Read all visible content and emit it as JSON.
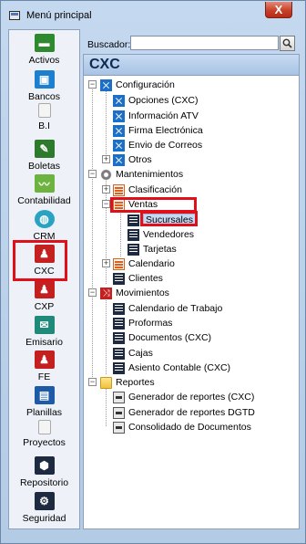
{
  "window": {
    "title": "Menú principal",
    "close_label": "X"
  },
  "sidebar": {
    "items": [
      {
        "label": "Activos",
        "icon": "activos-icon",
        "color": "#2f8a2f"
      },
      {
        "label": "Bancos",
        "icon": "bancos-icon",
        "color": "#1d7fd0"
      },
      {
        "label": "B.I",
        "icon": "bi-icon",
        "color": "#9a9a9a"
      },
      {
        "label": "Boletas",
        "icon": "boletas-icon",
        "color": "#2d7a2d"
      },
      {
        "label": "Contabilidad",
        "icon": "contabilidad-icon",
        "color": "#6db33f"
      },
      {
        "label": "CRM",
        "icon": "crm-icon",
        "color": "#2aa3c2"
      },
      {
        "label": "CXC",
        "icon": "cxc-icon",
        "color": "#c42020"
      },
      {
        "label": "CXP",
        "icon": "cxp-icon",
        "color": "#c42020"
      },
      {
        "label": "Emisario",
        "icon": "emisario-icon",
        "color": "#1f8a7a"
      },
      {
        "label": "FE",
        "icon": "fe-icon",
        "color": "#c42020"
      },
      {
        "label": "Planillas",
        "icon": "planillas-icon",
        "color": "#1d5aa8"
      },
      {
        "label": "Proyectos",
        "icon": "proyectos-icon",
        "color": "#9a9a9a"
      },
      {
        "label": "Repositorio",
        "icon": "repositorio-icon",
        "color": "#1d2a40"
      },
      {
        "label": "Seguridad",
        "icon": "seguridad-icon",
        "color": "#1d2a40"
      }
    ]
  },
  "search": {
    "label": "Buscador:",
    "value": ""
  },
  "panel": {
    "title": "CXC"
  },
  "tree": {
    "configuracion": "Configuración",
    "opciones": "Opciones (CXC)",
    "informacion_atv": "Información ATV",
    "firma": "Firma Electrónica",
    "envio": "Envio de Correos",
    "otros": "Otros",
    "mantenimientos": "Mantenimientos",
    "clasificacion": "Clasificación",
    "ventas": "Ventas",
    "sucursales": "Sucursales",
    "vendedores": "Vendedores",
    "tarjetas": "Tarjetas",
    "calendario": "Calendario",
    "clientes": "Clientes",
    "movimientos": "Movimientos",
    "calendario_trabajo": "Calendario de Trabajo",
    "proformas": "Proformas",
    "documentos": "Documentos (CXC)",
    "cajas": "Cajas",
    "asiento": "Asiento Contable (CXC)",
    "reportes": "Reportes",
    "gen_cxc": "Generador de reportes (CXC)",
    "gen_dgtd": "Generador de reportes DGTD",
    "consolidado": "Consolidado de Documentos"
  }
}
